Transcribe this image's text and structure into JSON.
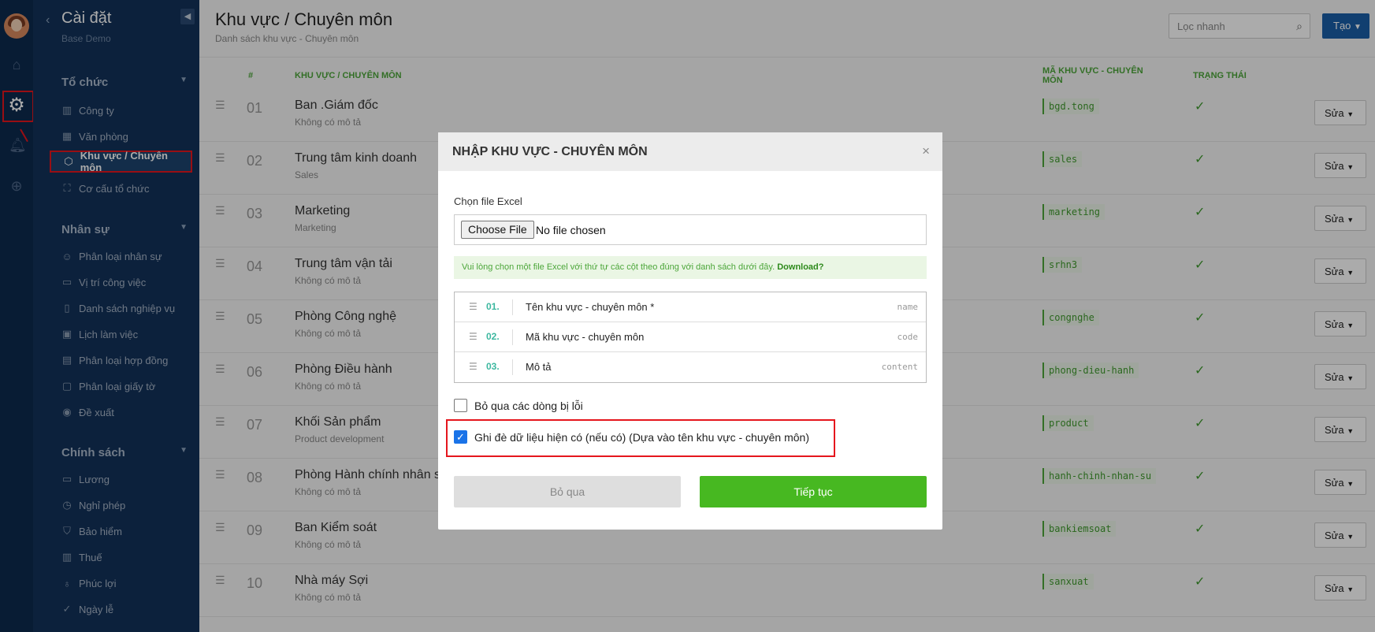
{
  "sidebar": {
    "title": "Cài đặt",
    "subtitle": "Base Demo",
    "groups": [
      {
        "label": "Tổ chức",
        "items": [
          {
            "label": "Công ty",
            "icon": "building-icon"
          },
          {
            "label": "Văn phòng",
            "icon": "office-icon"
          },
          {
            "label": "Khu vực / Chuyên môn",
            "icon": "cube-icon"
          },
          {
            "label": "Cơ cấu tổ chức",
            "icon": "org-chart-icon"
          }
        ]
      },
      {
        "label": "Nhân sự",
        "items": [
          {
            "label": "Phân loại nhân sự",
            "icon": "user-icon"
          },
          {
            "label": "Vị trí công việc",
            "icon": "briefcase-icon"
          },
          {
            "label": "Danh sách nghiệp vụ",
            "icon": "book-icon"
          },
          {
            "label": "Lịch làm việc",
            "icon": "calendar-icon"
          },
          {
            "label": "Phân loại hợp đồng",
            "icon": "contract-icon"
          },
          {
            "label": "Phân loại giấy tờ",
            "icon": "document-icon"
          },
          {
            "label": "Đề xuất",
            "icon": "broadcast-icon"
          }
        ]
      },
      {
        "label": "Chính sách",
        "items": [
          {
            "label": "Lương",
            "icon": "wallet-icon"
          },
          {
            "label": "Nghỉ phép",
            "icon": "clock-icon"
          },
          {
            "label": "Bảo hiểm",
            "icon": "shield-icon"
          },
          {
            "label": "Thuế",
            "icon": "tax-icon"
          },
          {
            "label": "Phúc lợi",
            "icon": "piggy-bank-icon"
          },
          {
            "label": "Ngày lễ",
            "icon": "check-circle-icon"
          }
        ]
      }
    ]
  },
  "header": {
    "title": "Khu vực / Chuyên môn",
    "subtitle": "Danh sách khu vực - Chuyên môn",
    "search_placeholder": "Lọc nhanh",
    "create_label": "Tạo"
  },
  "table": {
    "headers": {
      "num": "#",
      "name": "KHU VỰC / CHUYÊN MÔN",
      "code": "MÃ KHU VỰC - CHUYÊN MÔN",
      "status": "TRẠNG THÁI"
    },
    "edit_label": "Sửa",
    "check": "✓",
    "rows": [
      {
        "num": "01",
        "name": "Ban .Giám đốc",
        "desc": "Không có mô tả",
        "code": "bgd.tong"
      },
      {
        "num": "02",
        "name": "Trung tâm kinh doanh",
        "desc": "Sales",
        "code": "sales"
      },
      {
        "num": "03",
        "name": "Marketing",
        "desc": "Marketing",
        "code": "marketing"
      },
      {
        "num": "04",
        "name": "Trung tâm vận tải",
        "desc": "Không có mô tả",
        "code": "srhn3"
      },
      {
        "num": "05",
        "name": "Phòng Công nghệ",
        "desc": "Không có mô tả",
        "code": "congnghe"
      },
      {
        "num": "06",
        "name": "Phòng Điều hành",
        "desc": "Không có mô tả",
        "code": "phong-dieu-hanh"
      },
      {
        "num": "07",
        "name": "Khối Sản phẩm",
        "desc": "Product development",
        "code": "product"
      },
      {
        "num": "08",
        "name": "Phòng Hành chính nhân s",
        "desc": "Không có mô tả",
        "code": "hanh-chinh-nhan-su"
      },
      {
        "num": "09",
        "name": "Ban Kiểm soát",
        "desc": "Không có mô tả",
        "code": "bankiemsoat"
      },
      {
        "num": "10",
        "name": "Nhà máy Sợi",
        "desc": "Không có mô tả",
        "code": "sanxuat"
      }
    ]
  },
  "modal": {
    "title": "NHẬP KHU VỰC - CHUYÊN MÔN",
    "close": "×",
    "file_label": "Chọn file Excel",
    "file_button": "Choose File",
    "file_status": "No file chosen",
    "hint": "Vui lòng chọn một file Excel với thứ tự các cột theo đúng với danh sách dưới đây.",
    "hint_link": "Download?",
    "columns": [
      {
        "num": "01.",
        "label": "Tên khu vực - chuyên môn *",
        "key": "name"
      },
      {
        "num": "02.",
        "label": "Mã khu vực - chuyên môn",
        "key": "code"
      },
      {
        "num": "03.",
        "label": "Mô tả",
        "key": "content"
      }
    ],
    "skip_errors": {
      "label": "Bỏ qua các dòng bị lỗi",
      "checked": false
    },
    "overwrite": {
      "label": "Ghi đè dữ liệu hiện có (nếu có) (Dựa vào tên khu vực - chuyên môn)",
      "checked": true
    },
    "cancel_label": "Bỏ qua",
    "continue_label": "Tiếp tục"
  },
  "colors": {
    "accent_green": "#47b821",
    "primary_blue": "#1a5fa8",
    "sidebar_bg": "#12325a",
    "highlight_red": "#e5161d"
  }
}
